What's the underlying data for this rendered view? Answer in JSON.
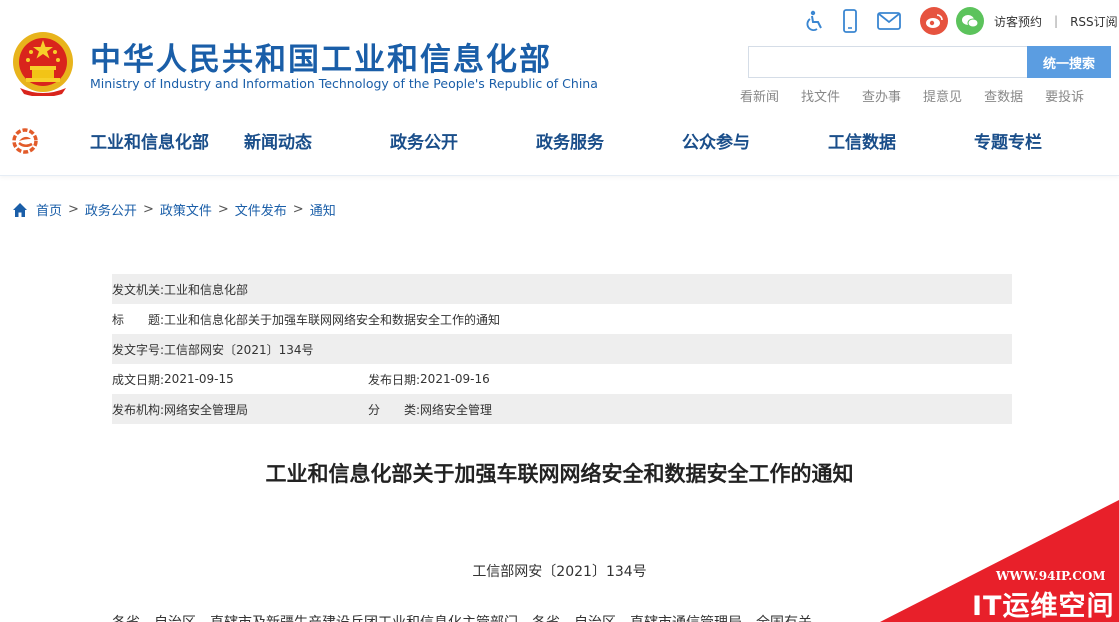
{
  "header": {
    "title_cn": "中华人民共和国工业和信息化部",
    "title_en": "Ministry of Industry and Information Technology of the People's Republic of China",
    "icons": [
      "accessibility-icon",
      "mobile-icon",
      "mail-icon",
      "weibo-icon",
      "wechat-icon"
    ],
    "visitor_booking": "访客预约",
    "separator": "|",
    "rss": "RSS订阅",
    "search": {
      "placeholder": "",
      "button": "统一搜索"
    },
    "quick_links": [
      "看新闻",
      "找文件",
      "查办事",
      "提意见",
      "查数据",
      "要投诉"
    ]
  },
  "nav": {
    "items": [
      "工业和信息化部",
      "新闻动态",
      "政务公开",
      "政务服务",
      "公众参与",
      "工信数据",
      "专题专栏"
    ]
  },
  "breadcrumb": {
    "items": [
      "首页",
      "政务公开",
      "政策文件",
      "文件发布",
      "通知"
    ],
    "arrow": ">"
  },
  "meta": {
    "issuer_label": "发文机关:",
    "issuer": "工业和信息化部",
    "title_label": "标　　题:",
    "title": "工业和信息化部关于加强车联网网络安全和数据安全工作的通知",
    "docnum_label": "发文字号:",
    "docnum": "工信部网安〔2021〕134号",
    "created_label": "成文日期:",
    "created": "2021-09-15",
    "published_label": "发布日期:",
    "published": "2021-09-16",
    "org_label": "发布机构:",
    "org": "网络安全管理局",
    "category_label": "分　　类:",
    "category": "网络安全管理"
  },
  "article": {
    "title": "工业和信息化部关于加强车联网网络安全和数据安全工作的通知",
    "doc_number": "工信部网安〔2021〕134号",
    "first_line": "各省、自治区、直辖市及新疆生产建设兵团工业和信息化主管部门，各省、自治区、直辖市通信管理局，全国有关"
  },
  "watermark": {
    "url": "WWW.94IP.COM",
    "text": "IT运维空间"
  },
  "colors": {
    "brand_blue": "#1a5ea8",
    "nav_text": "#1a4e8a",
    "search_button": "#5b9de1",
    "meta_shade": "#eeeeee",
    "watermark_red": "#e8202a"
  }
}
